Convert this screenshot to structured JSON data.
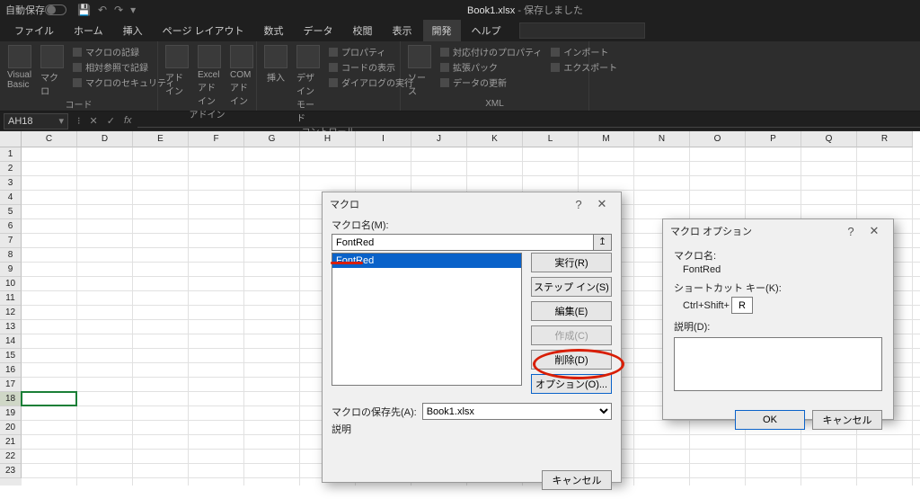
{
  "titlebar": {
    "autosave_label": "自動保存",
    "doc_name": "Book1.xlsx",
    "doc_status": "保存しました"
  },
  "tabs": {
    "file": "ファイル",
    "home": "ホーム",
    "insert": "挿入",
    "page_layout": "ページ レイアウト",
    "formulas": "数式",
    "data": "データ",
    "review": "校閲",
    "view": "表示",
    "developer": "開発",
    "help": "ヘルプ"
  },
  "ribbon": {
    "code": {
      "visual_basic": "Visual Basic",
      "macros": "マクロ",
      "record_macro": "マクロの記録",
      "relative_ref": "相対参照で記録",
      "macro_security": "マクロのセキュリティ",
      "group_label": "コード"
    },
    "addins": {
      "addin": "アドイン",
      "excel_addin": "Excel\nアドイン",
      "com_addin": "COM\nアドイン",
      "group_label": "アドイン"
    },
    "controls": {
      "insert": "挿入",
      "design_mode": "デザイン\nモード",
      "properties": "プロパティ",
      "view_code": "コードの表示",
      "run_dialog": "ダイアログの実行",
      "group_label": "コントロール"
    },
    "xml": {
      "source": "ソース",
      "map_props": "対応付けのプロパティ",
      "expansion": "拡張パック",
      "refresh": "データの更新",
      "import": "インポート",
      "export": "エクスポート",
      "group_label": "XML"
    }
  },
  "namebox": {
    "value": "AH18"
  },
  "fbar": {
    "dots": "⁝",
    "cancel": "✕",
    "confirm": "✓",
    "fx": "fx"
  },
  "columns": [
    "C",
    "D",
    "E",
    "F",
    "G",
    "H",
    "I",
    "J",
    "K",
    "L",
    "M",
    "N",
    "O",
    "P",
    "Q",
    "R"
  ],
  "rows": [
    "1",
    "2",
    "3",
    "4",
    "5",
    "6",
    "7",
    "8",
    "9",
    "10",
    "11",
    "12",
    "13",
    "14",
    "15",
    "16",
    "17",
    "18",
    "19",
    "20",
    "21",
    "22",
    "23"
  ],
  "selected_row": "18",
  "macro_dialog": {
    "title": "マクロ",
    "help": "?",
    "close": "✕",
    "name_label": "マクロ名(M):",
    "name_value": "FontRed",
    "ref_btn": "↥",
    "list_item": "FontRed",
    "btn_run": "実行(R)",
    "btn_step": "ステップ イン(S)",
    "btn_edit": "編集(E)",
    "btn_create": "作成(C)",
    "btn_delete": "削除(D)",
    "btn_options": "オプション(O)...",
    "store_label": "マクロの保存先(A):",
    "store_value": "Book1.xlsx",
    "desc_label": "説明",
    "btn_cancel": "キャンセル"
  },
  "options_dialog": {
    "title": "マクロ オプション",
    "help": "?",
    "close": "✕",
    "name_label": "マクロ名:",
    "name_value": "FontRed",
    "shortcut_label": "ショートカット キー(K):",
    "shortcut_prefix": "Ctrl+Shift+",
    "shortcut_key": "R",
    "desc_label": "説明(D):",
    "btn_ok": "OK",
    "btn_cancel": "キャンセル"
  }
}
